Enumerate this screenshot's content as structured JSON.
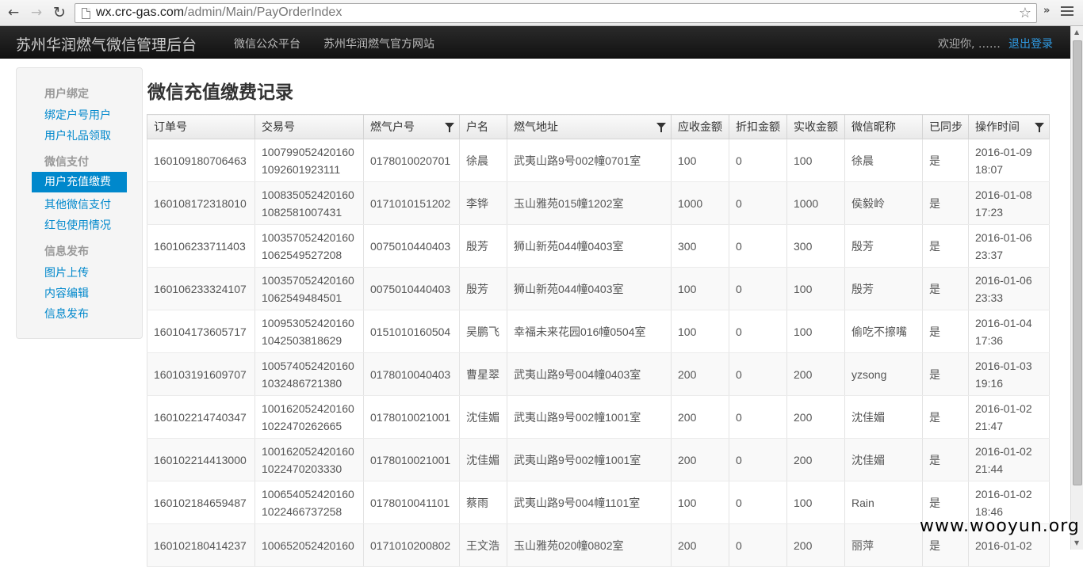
{
  "browser": {
    "url_host": "wx.crc-gas.com",
    "url_path": "/admin/Main/PayOrderIndex",
    "back_glyph": "←",
    "forward_glyph": "→",
    "reload_glyph": "↻",
    "star_glyph": "☆",
    "overflow_glyph": "»"
  },
  "navbar": {
    "brand": "苏州华润燃气微信管理后台",
    "links": [
      "微信公众平台",
      "苏州华润燃气官方网站"
    ],
    "welcome": "欢迎你, ……",
    "logout": "退出登录"
  },
  "sidebar": {
    "sections": [
      {
        "header": "用户绑定",
        "items": [
          "绑定户号用户",
          "用户礼品领取"
        ]
      },
      {
        "header": "微信支付",
        "items": [
          "用户充值缴费",
          "其他微信支付",
          "红包使用情况"
        ]
      },
      {
        "header": "信息发布",
        "items": [
          "图片上传",
          "内容编辑",
          "信息发布"
        ]
      }
    ],
    "active": "用户充值缴费"
  },
  "page": {
    "title": "微信充值缴费记录"
  },
  "table": {
    "columns": [
      "订单号",
      "交易号",
      "燃气户号",
      "户名",
      "燃气地址",
      "应收金额",
      "折扣金额",
      "实收金额",
      "微信昵称",
      "已同步",
      "操作时间"
    ],
    "rows": [
      [
        "160109180706463",
        "100799052420160",
        "1092601923111",
        "0178010020701",
        "徐晨",
        "武夷山路9号002幢0701室",
        "100",
        "0",
        "100",
        "徐晨",
        "是",
        "2016-01-09",
        "18:07"
      ],
      [
        "160108172318010",
        "100835052420160",
        "1082581007431",
        "0171010151202",
        "李铧",
        "玉山雅苑015幢1202室",
        "1000",
        "0",
        "1000",
        "侯毅岭",
        "是",
        "2016-01-08",
        "17:23"
      ],
      [
        "160106233711403",
        "100357052420160",
        "1062549527208",
        "0075010440403",
        "殷芳",
        "狮山新苑044幢0403室",
        "300",
        "0",
        "300",
        "殷芳",
        "是",
        "2016-01-06",
        "23:37"
      ],
      [
        "160106233324107",
        "100357052420160",
        "1062549484501",
        "0075010440403",
        "殷芳",
        "狮山新苑044幢0403室",
        "100",
        "0",
        "100",
        "殷芳",
        "是",
        "2016-01-06",
        "23:33"
      ],
      [
        "160104173605717",
        "100953052420160",
        "1042503818629",
        "0151010160504",
        "吴鹏飞",
        "幸福未来花园016幢0504室",
        "100",
        "0",
        "100",
        "偷吃不擦嘴",
        "是",
        "2016-01-04",
        "17:36"
      ],
      [
        "160103191609707",
        "100574052420160",
        "1032486721380",
        "0178010040403",
        "曹星翠",
        "武夷山路9号004幢0403室",
        "200",
        "0",
        "200",
        "yzsong",
        "是",
        "2016-01-03",
        "19:16"
      ],
      [
        "160102214740347",
        "100162052420160",
        "1022470262665",
        "0178010021001",
        "沈佳媚",
        "武夷山路9号002幢1001室",
        "200",
        "0",
        "200",
        "沈佳媚",
        "是",
        "2016-01-02",
        "21:47"
      ],
      [
        "160102214413000",
        "100162052420160",
        "1022470203330",
        "0178010021001",
        "沈佳媚",
        "武夷山路9号002幢1001室",
        "200",
        "0",
        "200",
        "沈佳媚",
        "是",
        "2016-01-02",
        "21:44"
      ],
      [
        "160102184659487",
        "100654052420160",
        "1022466737258",
        "0178010041101",
        "蔡雨",
        "武夷山路9号004幢1101室",
        "100",
        "0",
        "100",
        "Rain",
        "是",
        "2016-01-02",
        "18:46"
      ],
      [
        "160102180414237",
        "100652052420160",
        "",
        "0171010200802",
        "王文浩",
        "玉山雅苑020幢0802室",
        "200",
        "0",
        "200",
        "丽萍",
        "是",
        "2016-01-02",
        ""
      ]
    ]
  },
  "watermark": "www.wooyun.org"
}
